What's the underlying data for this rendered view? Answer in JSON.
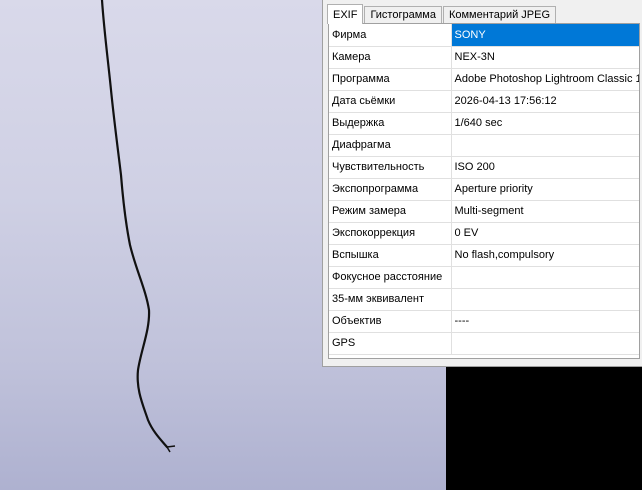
{
  "panel": {
    "tabs": [
      {
        "label": "EXIF"
      },
      {
        "label": "Гистограмма"
      },
      {
        "label": "Комментарий JPEG"
      }
    ],
    "rows": [
      {
        "label": "Фирма",
        "value": "SONY"
      },
      {
        "label": "Камера",
        "value": "NEX-3N"
      },
      {
        "label": "Программа",
        "value": "Adobe Photoshop Lightroom Classic 1"
      },
      {
        "label": "Дата сьёмки",
        "value": "2026-04-13 17:56:12"
      },
      {
        "label": "Выдержка",
        "value": "1/640 sec"
      },
      {
        "label": "Диафрагма",
        "value": ""
      },
      {
        "label": "Чувствительность",
        "value": "ISO 200"
      },
      {
        "label": "Экспопрограмма",
        "value": "Aperture priority"
      },
      {
        "label": "Режим замера",
        "value": "Multi-segment"
      },
      {
        "label": "Экспокоррекция",
        "value": "0 EV"
      },
      {
        "label": "Вспышка",
        "value": "No flash,compulsory"
      },
      {
        "label": "Фокусное расстояние",
        "value": ""
      },
      {
        "label": "35-мм эквивалент",
        "value": ""
      },
      {
        "label": "Объектив",
        "value": "----"
      },
      {
        "label": "GPS",
        "value": ""
      }
    ],
    "selected_row": 0,
    "selection_color": "#0078d7"
  }
}
